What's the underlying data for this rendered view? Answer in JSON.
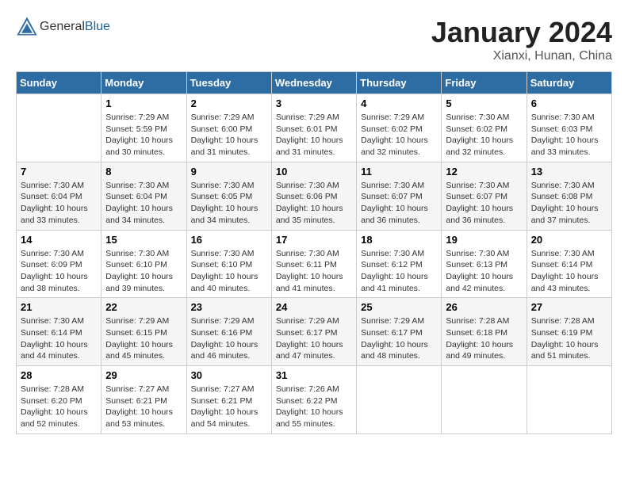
{
  "header": {
    "logo_general": "General",
    "logo_blue": "Blue",
    "month": "January 2024",
    "location": "Xianxi, Hunan, China"
  },
  "days_of_week": [
    "Sunday",
    "Monday",
    "Tuesday",
    "Wednesday",
    "Thursday",
    "Friday",
    "Saturday"
  ],
  "weeks": [
    [
      {
        "day": "",
        "info": ""
      },
      {
        "day": "1",
        "info": "Sunrise: 7:29 AM\nSunset: 5:59 PM\nDaylight: 10 hours\nand 30 minutes."
      },
      {
        "day": "2",
        "info": "Sunrise: 7:29 AM\nSunset: 6:00 PM\nDaylight: 10 hours\nand 31 minutes."
      },
      {
        "day": "3",
        "info": "Sunrise: 7:29 AM\nSunset: 6:01 PM\nDaylight: 10 hours\nand 31 minutes."
      },
      {
        "day": "4",
        "info": "Sunrise: 7:29 AM\nSunset: 6:02 PM\nDaylight: 10 hours\nand 32 minutes."
      },
      {
        "day": "5",
        "info": "Sunrise: 7:30 AM\nSunset: 6:02 PM\nDaylight: 10 hours\nand 32 minutes."
      },
      {
        "day": "6",
        "info": "Sunrise: 7:30 AM\nSunset: 6:03 PM\nDaylight: 10 hours\nand 33 minutes."
      }
    ],
    [
      {
        "day": "7",
        "info": "Sunrise: 7:30 AM\nSunset: 6:04 PM\nDaylight: 10 hours\nand 33 minutes."
      },
      {
        "day": "8",
        "info": "Sunrise: 7:30 AM\nSunset: 6:04 PM\nDaylight: 10 hours\nand 34 minutes."
      },
      {
        "day": "9",
        "info": "Sunrise: 7:30 AM\nSunset: 6:05 PM\nDaylight: 10 hours\nand 34 minutes."
      },
      {
        "day": "10",
        "info": "Sunrise: 7:30 AM\nSunset: 6:06 PM\nDaylight: 10 hours\nand 35 minutes."
      },
      {
        "day": "11",
        "info": "Sunrise: 7:30 AM\nSunset: 6:07 PM\nDaylight: 10 hours\nand 36 minutes."
      },
      {
        "day": "12",
        "info": "Sunrise: 7:30 AM\nSunset: 6:07 PM\nDaylight: 10 hours\nand 36 minutes."
      },
      {
        "day": "13",
        "info": "Sunrise: 7:30 AM\nSunset: 6:08 PM\nDaylight: 10 hours\nand 37 minutes."
      }
    ],
    [
      {
        "day": "14",
        "info": "Sunrise: 7:30 AM\nSunset: 6:09 PM\nDaylight: 10 hours\nand 38 minutes."
      },
      {
        "day": "15",
        "info": "Sunrise: 7:30 AM\nSunset: 6:10 PM\nDaylight: 10 hours\nand 39 minutes."
      },
      {
        "day": "16",
        "info": "Sunrise: 7:30 AM\nSunset: 6:10 PM\nDaylight: 10 hours\nand 40 minutes."
      },
      {
        "day": "17",
        "info": "Sunrise: 7:30 AM\nSunset: 6:11 PM\nDaylight: 10 hours\nand 41 minutes."
      },
      {
        "day": "18",
        "info": "Sunrise: 7:30 AM\nSunset: 6:12 PM\nDaylight: 10 hours\nand 41 minutes."
      },
      {
        "day": "19",
        "info": "Sunrise: 7:30 AM\nSunset: 6:13 PM\nDaylight: 10 hours\nand 42 minutes."
      },
      {
        "day": "20",
        "info": "Sunrise: 7:30 AM\nSunset: 6:14 PM\nDaylight: 10 hours\nand 43 minutes."
      }
    ],
    [
      {
        "day": "21",
        "info": "Sunrise: 7:30 AM\nSunset: 6:14 PM\nDaylight: 10 hours\nand 44 minutes."
      },
      {
        "day": "22",
        "info": "Sunrise: 7:29 AM\nSunset: 6:15 PM\nDaylight: 10 hours\nand 45 minutes."
      },
      {
        "day": "23",
        "info": "Sunrise: 7:29 AM\nSunset: 6:16 PM\nDaylight: 10 hours\nand 46 minutes."
      },
      {
        "day": "24",
        "info": "Sunrise: 7:29 AM\nSunset: 6:17 PM\nDaylight: 10 hours\nand 47 minutes."
      },
      {
        "day": "25",
        "info": "Sunrise: 7:29 AM\nSunset: 6:17 PM\nDaylight: 10 hours\nand 48 minutes."
      },
      {
        "day": "26",
        "info": "Sunrise: 7:28 AM\nSunset: 6:18 PM\nDaylight: 10 hours\nand 49 minutes."
      },
      {
        "day": "27",
        "info": "Sunrise: 7:28 AM\nSunset: 6:19 PM\nDaylight: 10 hours\nand 51 minutes."
      }
    ],
    [
      {
        "day": "28",
        "info": "Sunrise: 7:28 AM\nSunset: 6:20 PM\nDaylight: 10 hours\nand 52 minutes."
      },
      {
        "day": "29",
        "info": "Sunrise: 7:27 AM\nSunset: 6:21 PM\nDaylight: 10 hours\nand 53 minutes."
      },
      {
        "day": "30",
        "info": "Sunrise: 7:27 AM\nSunset: 6:21 PM\nDaylight: 10 hours\nand 54 minutes."
      },
      {
        "day": "31",
        "info": "Sunrise: 7:26 AM\nSunset: 6:22 PM\nDaylight: 10 hours\nand 55 minutes."
      },
      {
        "day": "",
        "info": ""
      },
      {
        "day": "",
        "info": ""
      },
      {
        "day": "",
        "info": ""
      }
    ]
  ]
}
